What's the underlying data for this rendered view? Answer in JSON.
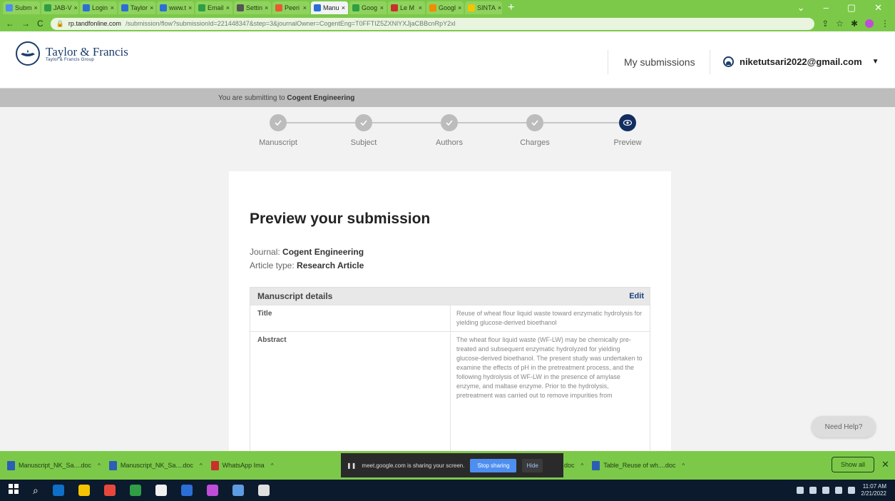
{
  "browser": {
    "tabs": [
      {
        "label": "Subm",
        "color": "#4d8ff0"
      },
      {
        "label": "JAB-V",
        "color": "#2f9e44"
      },
      {
        "label": "Login",
        "color": "#2b6fd6"
      },
      {
        "label": "Taylor",
        "color": "#2b6fd6"
      },
      {
        "label": "www.t",
        "color": "#2b6fd6"
      },
      {
        "label": "Email",
        "color": "#2f9e44"
      },
      {
        "label": "Settin",
        "color": "#555555"
      },
      {
        "label": "Peeri",
        "color": "#e65c2e"
      },
      {
        "label": "Manu",
        "color": "#2b6fd6",
        "active": true
      },
      {
        "label": "Goog",
        "color": "#2f9e44"
      },
      {
        "label": "Le M",
        "color": "#c9302c"
      },
      {
        "label": "Googl",
        "color": "#f08c00"
      },
      {
        "label": "SINTA",
        "color": "#f5c400"
      }
    ],
    "url_host": "rp.tandfonline.com",
    "url_path": "/submission/flow?submissionId=221448347&step=3&journalOwner=CogentEng=T0FFTIZ5ZXNlYXJjaCBBcnRpY2xl"
  },
  "header": {
    "brand_name": "Taylor & Francis",
    "brand_sub": "Taylor & Francis Group",
    "nav_label": "My submissions",
    "user_email": "niketutsari2022@gmail.com"
  },
  "banner": {
    "prefix": "You are submitting to",
    "journal": "Cogent Engineering"
  },
  "steps": [
    {
      "label": "Manuscript",
      "state": "done"
    },
    {
      "label": "Subject",
      "state": "done"
    },
    {
      "label": "Authors",
      "state": "done"
    },
    {
      "label": "Charges",
      "state": "done"
    },
    {
      "label": "Preview",
      "state": "current"
    }
  ],
  "preview": {
    "title": "Preview your submission",
    "journal_label": "Journal:",
    "journal_value": "Cogent Engineering",
    "article_type_label": "Article type:",
    "article_type_value": "Research Article",
    "section_title": "Manuscript details",
    "edit_label": "Edit",
    "rows": [
      {
        "key": "Title",
        "value": "Reuse of wheat flour liquid waste toward enzymatic hydrolysis for yielding glucose-derived bioethanol"
      },
      {
        "key": "Abstract",
        "value": "The wheat flour liquid waste (WF-LW) may be chemically pre-treated and subsequent enzymatic hydrolyzed for yielding glucose-derived bioethanol. The present study was undertaken to examine the effects of pH in the pretreatment process, and the following hydrolysis of WF-LW in the presence of amylase enzyme, and maltase enzyme. Prior to the hydrolysis, pretreatment was carried out to remove impurities from"
      }
    ]
  },
  "need_help": "Need Help?",
  "downloads": [
    {
      "name": "Manuscript_NK_Sa....doc",
      "kind": "doc"
    },
    {
      "name": "Manuscript_NK_Sa....doc",
      "kind": "doc"
    },
    {
      "name": "WhatsApp Ima",
      "kind": "pdf"
    },
    {
      "name": "...ent_Reuse of w....doc",
      "kind": "doc"
    },
    {
      "name": "Table_Reuse of wh....doc",
      "kind": "doc"
    }
  ],
  "screen_share": {
    "message": "meet.google.com is sharing your screen.",
    "stop_label": "Stop sharing",
    "hide_label": "Hide"
  },
  "show_all": "Show all",
  "taskbar": {
    "apps": [
      "#0f6fc6",
      "#f5c400",
      "#e8483c",
      "#2f9e44",
      "#f0f0f0",
      "#2b6fd6",
      "#c04dd8",
      "#5e9be0",
      "#e0e0e0"
    ],
    "time": "11:07 AM",
    "date": "2/21/2022"
  }
}
